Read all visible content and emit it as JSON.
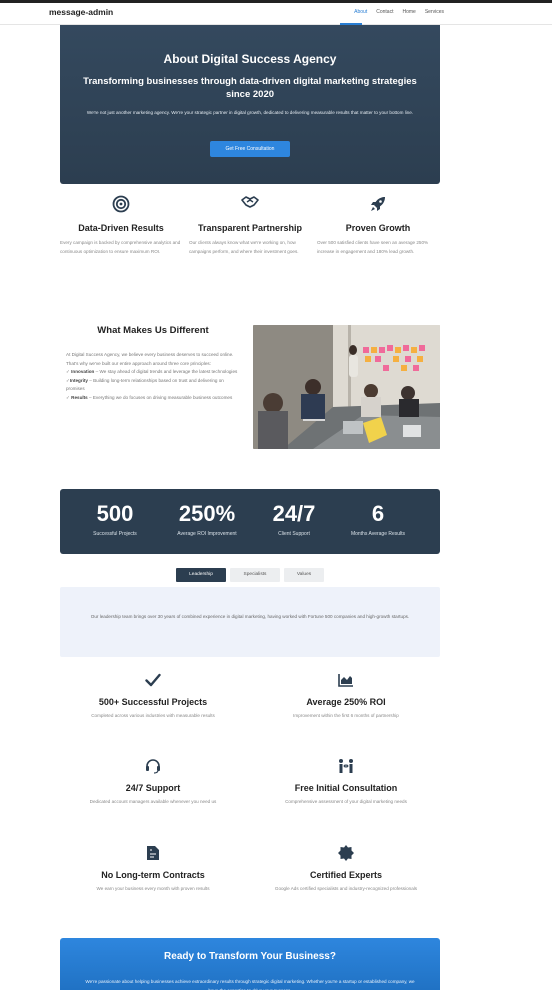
{
  "navbar": {
    "brand": "message-admin",
    "links": [
      "About",
      "Contact",
      "Home",
      "Services"
    ]
  },
  "hero": {
    "title": "About Digital Success Agency",
    "subtitle": "Transforming businesses through data-driven digital marketing strategies since 2020",
    "description": "We're not just another marketing agency. We're your strategic partner in digital growth, dedicated to delivering measurable results that matter to your bottom line.",
    "cta_label": "Get Free Consultation"
  },
  "features": [
    {
      "icon": "target-icon",
      "title": "Data-Driven Results",
      "text": "Every campaign is backed by comprehensive analytics and continuous optimization to ensure maximum ROI."
    },
    {
      "icon": "handshake-icon",
      "title": "Transparent Partnership",
      "text": "Our clients always know what we're working on, how campaigns perform, and where their investment goes."
    },
    {
      "icon": "rocket-icon",
      "title": "Proven Growth",
      "text": "Over 500 satisfied clients have seen an average 250% increase in engagement and 180% lead growth."
    }
  ],
  "difference": {
    "title": "What Makes Us Different",
    "intro": "At Digital Success Agency, we believe every business deserves to succeed online. That's why we've built our entire approach around three core principles:",
    "principles": [
      {
        "mark": "✓",
        "name": "Innovation",
        "text": "– We stay ahead of digital trends and leverage the latest technologies"
      },
      {
        "mark": "✓",
        "name": "Integrity",
        "text": "– Building long-term relationships based on trust and delivering on promises"
      },
      {
        "mark": "✓",
        "name": "Results",
        "text": "– Everything we do focuses on driving measurable business outcomes"
      }
    ]
  },
  "stats": [
    {
      "value": "500",
      "label": "Successful Projects"
    },
    {
      "value": "250%",
      "label": "Average ROI Improvement"
    },
    {
      "value": "24/7",
      "label": "Client Support"
    },
    {
      "value": "6",
      "label": "Months Average Results"
    }
  ],
  "tabs": {
    "items": [
      "Leadership",
      "Specialists",
      "Values"
    ],
    "active": "Leadership",
    "panel_text": "Our leadership team brings over 30 years of combined experience in digital marketing, having worked with Fortune 500 companies and high-growth startups."
  },
  "benefits": [
    {
      "icon": "checkmark-icon",
      "title": "500+ Successful Projects",
      "text": "Completed across various industries with measurable results"
    },
    {
      "icon": "area-chart-icon",
      "title": "Average 250% ROI",
      "text": "Improvement within the first 6 months of partnership"
    },
    {
      "icon": "headset-icon",
      "title": "24/7 Support",
      "text": "Dedicated account managers available whenever you need us"
    },
    {
      "icon": "people-arrows-icon",
      "title": "Free Initial Consultation",
      "text": "Comprehensive assessment of your digital marketing needs"
    },
    {
      "icon": "contract-icon",
      "title": "No Long-term Contracts",
      "text": "We earn your business every month with proven results"
    },
    {
      "icon": "certificate-icon",
      "title": "Certified Experts",
      "text": "Google Ads certified specialists and industry-recognized professionals"
    }
  ],
  "cta": {
    "title": "Ready to Transform Your Business?",
    "text": "We're passionate about helping businesses achieve extraordinary results through strategic digital marketing. Whether you're a startup or established company, we have the expertise to drive your success."
  },
  "colors": {
    "hero_bg": "#2c3e50",
    "accent": "#2e86de",
    "stats_bg": "#2c3e50",
    "panel_bg": "#eef2fa"
  }
}
